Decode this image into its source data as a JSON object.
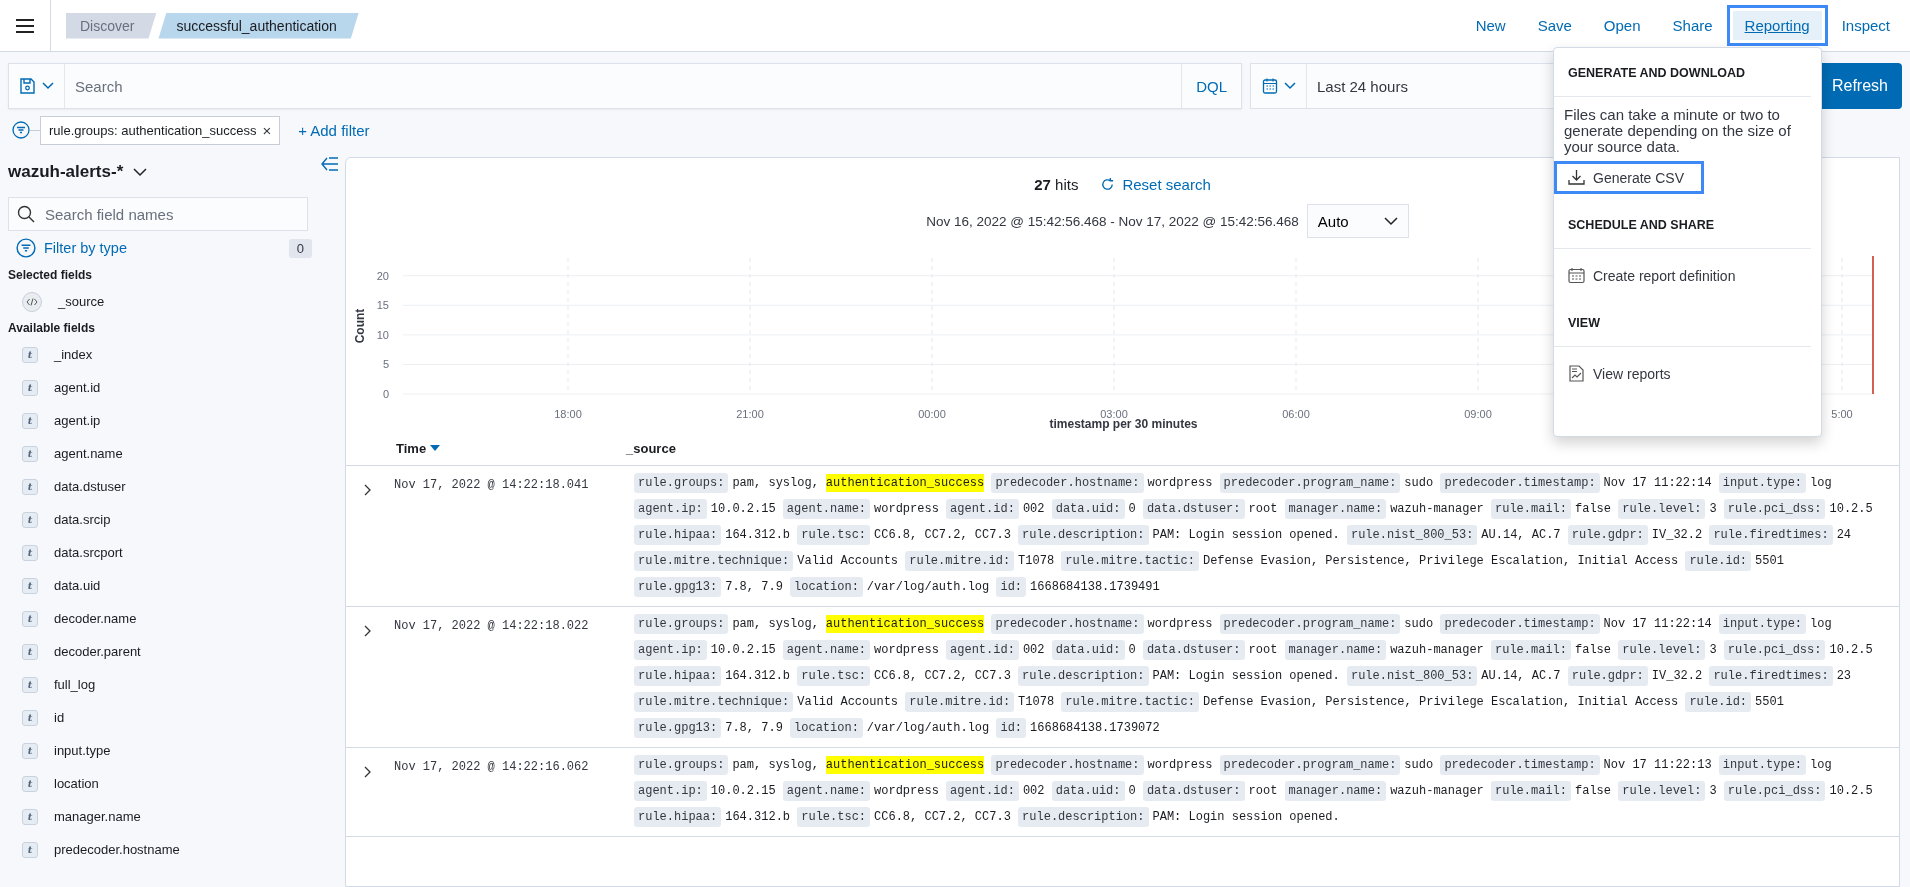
{
  "breadcrumbs": [
    {
      "label": "Discover",
      "selected": false
    },
    {
      "label": "successful_authentication",
      "selected": true
    }
  ],
  "top_nav": [
    {
      "label": "New",
      "selected": false
    },
    {
      "label": "Save",
      "selected": false
    },
    {
      "label": "Open",
      "selected": false
    },
    {
      "label": "Share",
      "selected": false
    },
    {
      "label": "Reporting",
      "selected": true
    },
    {
      "label": "Inspect",
      "selected": false
    }
  ],
  "query_bar": {
    "placeholder": "Search",
    "language": "DQL",
    "time_range": "Last 24 hours",
    "refresh": "Refresh"
  },
  "filters": [
    {
      "label": "rule.groups: authentication_success",
      "remove": "×"
    }
  ],
  "add_filter": "+ Add filter",
  "sidebar": {
    "index_pattern": "wazuh-alerts-*",
    "search_placeholder": "Search field names",
    "filter_by_type": "Filter by type",
    "filter_count": "0",
    "selected_heading": "Selected fields",
    "selected_fields": [
      {
        "name": "_source",
        "kind": "source"
      }
    ],
    "available_heading": "Available fields",
    "available_fields": [
      {
        "name": "_index",
        "kind": "string",
        "icon": "t"
      },
      {
        "name": "agent.id",
        "kind": "string",
        "icon": "t"
      },
      {
        "name": "agent.ip",
        "kind": "string",
        "icon": "t"
      },
      {
        "name": "agent.name",
        "kind": "string",
        "icon": "t"
      },
      {
        "name": "data.dstuser",
        "kind": "string",
        "icon": "t"
      },
      {
        "name": "data.srcip",
        "kind": "string",
        "icon": "t"
      },
      {
        "name": "data.srcport",
        "kind": "string",
        "icon": "t"
      },
      {
        "name": "data.uid",
        "kind": "string",
        "icon": "t"
      },
      {
        "name": "decoder.name",
        "kind": "string",
        "icon": "t"
      },
      {
        "name": "decoder.parent",
        "kind": "string",
        "icon": "t"
      },
      {
        "name": "full_log",
        "kind": "string",
        "icon": "t"
      },
      {
        "name": "id",
        "kind": "string",
        "icon": "t"
      },
      {
        "name": "input.type",
        "kind": "string",
        "icon": "t"
      },
      {
        "name": "location",
        "kind": "string",
        "icon": "t"
      },
      {
        "name": "manager.name",
        "kind": "string",
        "icon": "t"
      },
      {
        "name": "predecoder.hostname",
        "kind": "string",
        "icon": "t"
      }
    ]
  },
  "results": {
    "hits_count": "27",
    "hits_label": "hits",
    "reset": "Reset search",
    "date_range": "Nov 16, 2022 @ 15:42:56.468 - Nov 17, 2022 @ 15:42:56.468",
    "interval": "Auto",
    "chart_data": {
      "type": "bar",
      "xlabel": "timestamp per 30 minutes",
      "ylabel": "Count",
      "ylim": [
        0,
        23
      ],
      "yticks": [
        0,
        5,
        10,
        15,
        20
      ],
      "categories": [
        "18:00",
        "21:00",
        "00:00",
        "03:00",
        "06:00",
        "09:00",
        null,
        "5:00"
      ],
      "grid": true
    },
    "columns": [
      {
        "label": "Time",
        "sorted": true
      },
      {
        "label": "_source",
        "sorted": false
      }
    ],
    "rows": [
      {
        "time": "Nov 17, 2022 @ 14:22:18.041",
        "fields": [
          {
            "key": "rule.groups:",
            "value": "pam, syslog,",
            "highlight": "authentication_success"
          },
          {
            "key": "predecoder.hostname:",
            "value": "wordpress"
          },
          {
            "key": "predecoder.program_name:",
            "value": "sudo"
          },
          {
            "key": "predecoder.timestamp:",
            "value": "Nov 17 11:22:14"
          },
          {
            "key": "input.type:",
            "value": "log"
          },
          {
            "key": "agent.ip:",
            "value": "10.0.2.15"
          },
          {
            "key": "agent.name:",
            "value": "wordpress"
          },
          {
            "key": "agent.id:",
            "value": "002"
          },
          {
            "key": "data.uid:",
            "value": "0"
          },
          {
            "key": "data.dstuser:",
            "value": "root"
          },
          {
            "key": "manager.name:",
            "value": "wazuh-manager"
          },
          {
            "key": "rule.mail:",
            "value": "false"
          },
          {
            "key": "rule.level:",
            "value": "3"
          },
          {
            "key": "rule.pci_dss:",
            "value": "10.2.5"
          },
          {
            "key": "rule.hipaa:",
            "value": "164.312.b"
          },
          {
            "key": "rule.tsc:",
            "value": "CC6.8, CC7.2, CC7.3"
          },
          {
            "key": "rule.description:",
            "value": "PAM: Login session opened."
          },
          {
            "key": "rule.nist_800_53:",
            "value": "AU.14, AC.7"
          },
          {
            "key": "rule.gdpr:",
            "value": "IV_32.2"
          },
          {
            "key": "rule.firedtimes:",
            "value": "24"
          },
          {
            "key": "rule.mitre.technique:",
            "value": "Valid Accounts"
          },
          {
            "key": "rule.mitre.id:",
            "value": "T1078"
          },
          {
            "key": "rule.mitre.tactic:",
            "value": "Defense Evasion, Persistence, Privilege Escalation, Initial Access"
          },
          {
            "key": "rule.id:",
            "value": "5501"
          },
          {
            "key": "rule.gpg13:",
            "value": "7.8, 7.9"
          },
          {
            "key": "location:",
            "value": "/var/log/auth.log"
          },
          {
            "key": "id:",
            "value": "1668684138.1739491"
          }
        ]
      },
      {
        "time": "Nov 17, 2022 @ 14:22:18.022",
        "fields": [
          {
            "key": "rule.groups:",
            "value": "pam, syslog,",
            "highlight": "authentication_success"
          },
          {
            "key": "predecoder.hostname:",
            "value": "wordpress"
          },
          {
            "key": "predecoder.program_name:",
            "value": "sudo"
          },
          {
            "key": "predecoder.timestamp:",
            "value": "Nov 17 11:22:14"
          },
          {
            "key": "input.type:",
            "value": "log"
          },
          {
            "key": "agent.ip:",
            "value": "10.0.2.15"
          },
          {
            "key": "agent.name:",
            "value": "wordpress"
          },
          {
            "key": "agent.id:",
            "value": "002"
          },
          {
            "key": "data.uid:",
            "value": "0"
          },
          {
            "key": "data.dstuser:",
            "value": "root"
          },
          {
            "key": "manager.name:",
            "value": "wazuh-manager"
          },
          {
            "key": "rule.mail:",
            "value": "false"
          },
          {
            "key": "rule.level:",
            "value": "3"
          },
          {
            "key": "rule.pci_dss:",
            "value": "10.2.5"
          },
          {
            "key": "rule.hipaa:",
            "value": "164.312.b"
          },
          {
            "key": "rule.tsc:",
            "value": "CC6.8, CC7.2, CC7.3"
          },
          {
            "key": "rule.description:",
            "value": "PAM: Login session opened."
          },
          {
            "key": "rule.nist_800_53:",
            "value": "AU.14, AC.7"
          },
          {
            "key": "rule.gdpr:",
            "value": "IV_32.2"
          },
          {
            "key": "rule.firedtimes:",
            "value": "23"
          },
          {
            "key": "rule.mitre.technique:",
            "value": "Valid Accounts"
          },
          {
            "key": "rule.mitre.id:",
            "value": "T1078"
          },
          {
            "key": "rule.mitre.tactic:",
            "value": "Defense Evasion, Persistence, Privilege Escalation, Initial Access"
          },
          {
            "key": "rule.id:",
            "value": "5501"
          },
          {
            "key": "rule.gpg13:",
            "value": "7.8, 7.9"
          },
          {
            "key": "location:",
            "value": "/var/log/auth.log"
          },
          {
            "key": "id:",
            "value": "1668684138.1739072"
          }
        ]
      },
      {
        "time": "Nov 17, 2022 @ 14:22:16.062",
        "fields": [
          {
            "key": "rule.groups:",
            "value": "pam, syslog,",
            "highlight": "authentication_success"
          },
          {
            "key": "predecoder.hostname:",
            "value": "wordpress"
          },
          {
            "key": "predecoder.program_name:",
            "value": "sudo"
          },
          {
            "key": "predecoder.timestamp:",
            "value": "Nov 17 11:22:13"
          },
          {
            "key": "input.type:",
            "value": "log"
          },
          {
            "key": "agent.ip:",
            "value": "10.0.2.15"
          },
          {
            "key": "agent.name:",
            "value": "wordpress"
          },
          {
            "key": "agent.id:",
            "value": "002"
          },
          {
            "key": "data.uid:",
            "value": "0"
          },
          {
            "key": "data.dstuser:",
            "value": "root"
          },
          {
            "key": "manager.name:",
            "value": "wazuh-manager"
          },
          {
            "key": "rule.mail:",
            "value": "false"
          },
          {
            "key": "rule.level:",
            "value": "3"
          },
          {
            "key": "rule.pci_dss:",
            "value": "10.2.5"
          },
          {
            "key": "rule.hipaa:",
            "value": "164.312.b"
          },
          {
            "key": "rule.tsc:",
            "value": "CC6.8, CC7.2, CC7.3"
          },
          {
            "key": "rule.description:",
            "value": "PAM: Login session opened."
          }
        ]
      }
    ]
  },
  "reporting_menu": {
    "sections": [
      {
        "heading": "GENERATE AND DOWNLOAD",
        "text": "Files can take a minute or two to generate depending on the size of your source data.",
        "items": [
          {
            "label": "Generate CSV",
            "kind": "download",
            "highlighted": true
          }
        ]
      },
      {
        "heading": "SCHEDULE AND SHARE",
        "items": [
          {
            "label": "Create report definition",
            "kind": "calendar",
            "highlighted": false
          }
        ]
      },
      {
        "heading": "VIEW",
        "items": [
          {
            "label": "View reports",
            "kind": "report",
            "highlighted": false
          }
        ]
      }
    ]
  }
}
